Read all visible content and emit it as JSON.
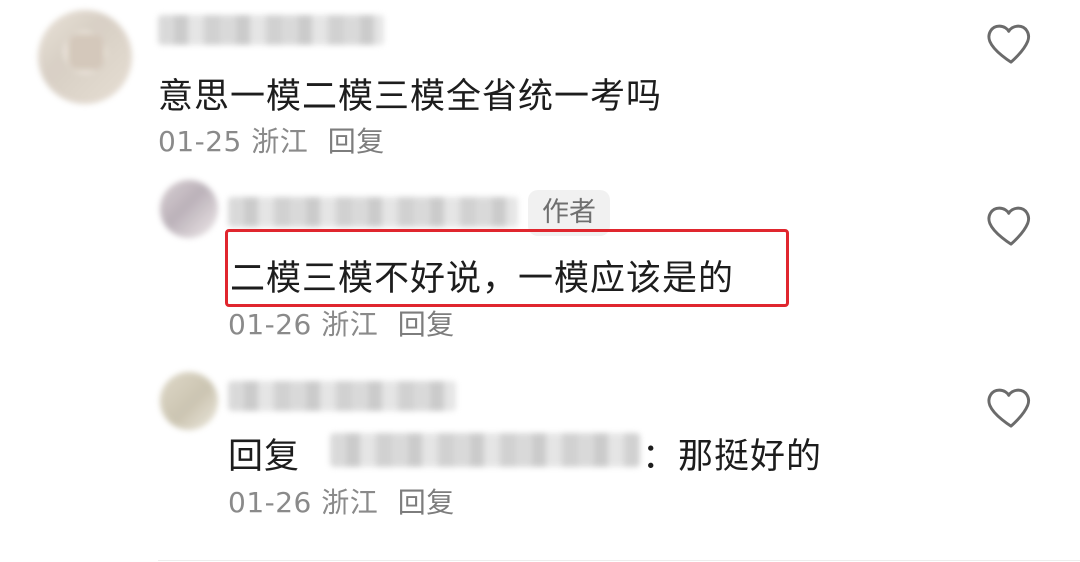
{
  "comments": [
    {
      "text": "意思一模二模三模全省统一考吗",
      "date": "01-25",
      "location": "浙江",
      "reply_label": "回复",
      "like_icon": "heart-outline-icon"
    }
  ],
  "replies": [
    {
      "author_badge": "作者",
      "text": "二模三模不好说，一模应该是的",
      "date": "01-26",
      "location": "浙江",
      "reply_label": "回复",
      "like_icon": "heart-outline-icon",
      "highlight_color": "#e0262e"
    },
    {
      "reply_prefix": "回复",
      "text": "：那挺好的",
      "date": "01-26",
      "location": "浙江",
      "reply_label": "回复",
      "like_icon": "heart-outline-icon"
    }
  ]
}
